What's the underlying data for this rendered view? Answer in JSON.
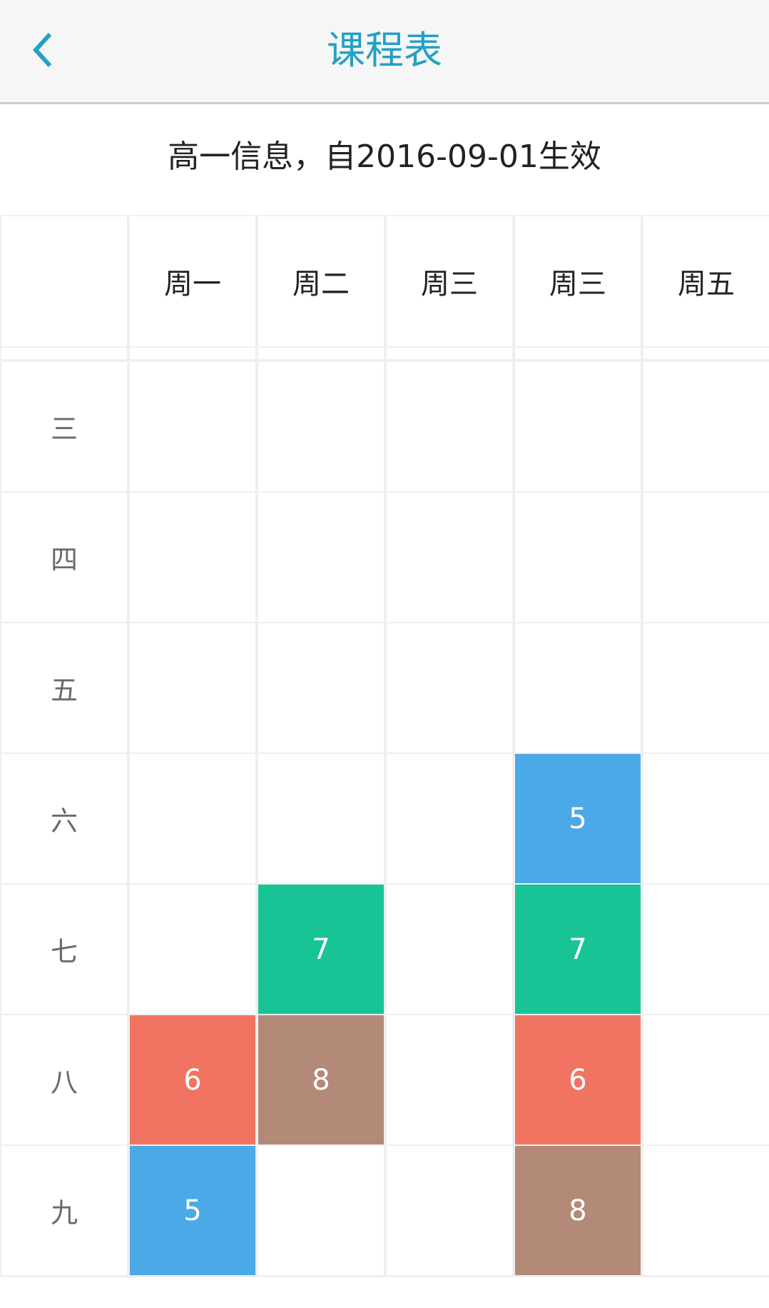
{
  "header": {
    "title": "课程表",
    "back_icon": "chevron-left-icon",
    "accent": "#22a1c4"
  },
  "subtitle": "高一信息，自2016-09-01生效",
  "columns": [
    "",
    "周一",
    "周二",
    "周三",
    "周三",
    "周五"
  ],
  "rows": [
    {
      "label": "",
      "cells": [
        "",
        "",
        "",
        "",
        ""
      ]
    },
    {
      "label": "三",
      "cells": [
        "",
        "",
        "",
        "",
        ""
      ]
    },
    {
      "label": "四",
      "cells": [
        "",
        "",
        "",
        "",
        ""
      ]
    },
    {
      "label": "五",
      "cells": [
        "",
        "",
        "",
        "",
        ""
      ]
    },
    {
      "label": "六",
      "cells": [
        "",
        "",
        "",
        "5",
        ""
      ]
    },
    {
      "label": "七",
      "cells": [
        "",
        "7",
        "",
        "7",
        ""
      ]
    },
    {
      "label": "八",
      "cells": [
        "6",
        "8",
        "",
        "6",
        ""
      ]
    },
    {
      "label": "九",
      "cells": [
        "5",
        "",
        "",
        "8",
        ""
      ]
    }
  ],
  "course_colors": {
    "5": "#4ca9e8",
    "6": "#f07461",
    "7": "#18c496",
    "8": "#b38977"
  }
}
